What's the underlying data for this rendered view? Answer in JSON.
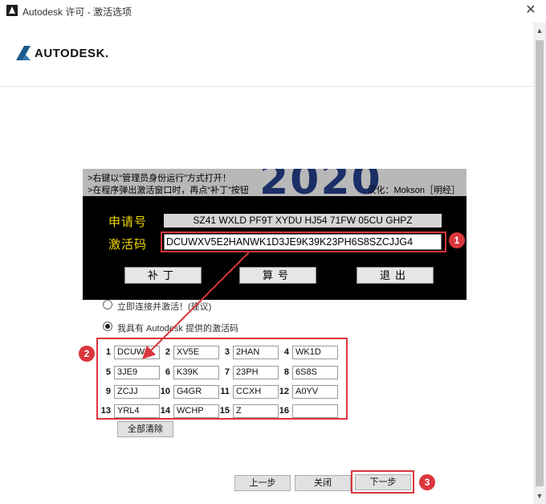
{
  "window": {
    "title": "Autodesk 许可 - 激活选项",
    "close_glyph": "✕"
  },
  "header": {
    "brand": "AUTODESK."
  },
  "patch_tool": {
    "bg_number": "2020",
    "instruction_1": ">右键以“管理员身份运行”方式打开！",
    "instruction_2": ">在程序弹出激活窗口时，再点“补丁”按钮",
    "credit": "汉化：Mokson［明经］",
    "request_label": "申请号",
    "request_code": "SZ41 WXLD PF9T XYDU HJ54 71FW 05CU GHPZ",
    "activation_label": "激活码",
    "activation_code": "DCUWXV5E2HANWK1D3JE9K39K23PH6S8SZCJJG4",
    "buttons": {
      "patch": "补丁",
      "generate": "算号",
      "exit": "退出"
    }
  },
  "options": {
    "connect": "立即连接并激活！(建议)",
    "have_code": "我具有 Autodesk 提供的激活码"
  },
  "codes": [
    {
      "n": "1",
      "v": "DCUW"
    },
    {
      "n": "2",
      "v": "XV5E"
    },
    {
      "n": "3",
      "v": "2HAN"
    },
    {
      "n": "4",
      "v": "WK1D"
    },
    {
      "n": "5",
      "v": "3JE9"
    },
    {
      "n": "6",
      "v": "K39K"
    },
    {
      "n": "7",
      "v": "23PH"
    },
    {
      "n": "8",
      "v": "6S8S"
    },
    {
      "n": "9",
      "v": "ZCJJ"
    },
    {
      "n": "10",
      "v": "G4GR"
    },
    {
      "n": "11",
      "v": "CCXH"
    },
    {
      "n": "12",
      "v": "A0YV"
    },
    {
      "n": "13",
      "v": "YRL4"
    },
    {
      "n": "14",
      "v": "WCHP"
    },
    {
      "n": "15",
      "v": "Z"
    },
    {
      "n": "16",
      "v": ""
    }
  ],
  "clear_all": "全部清除",
  "footer": {
    "back": "上一步",
    "close": "关闭",
    "next": "下一步"
  },
  "annotations": {
    "step1": "1",
    "step2": "2",
    "step3": "3",
    "color": "#d9363c"
  },
  "colors": {
    "patch_bg": "#000000",
    "patch_label": "#f2d700",
    "bg_number": "#1a2f66",
    "brand_mark": "#1b5a8a"
  }
}
